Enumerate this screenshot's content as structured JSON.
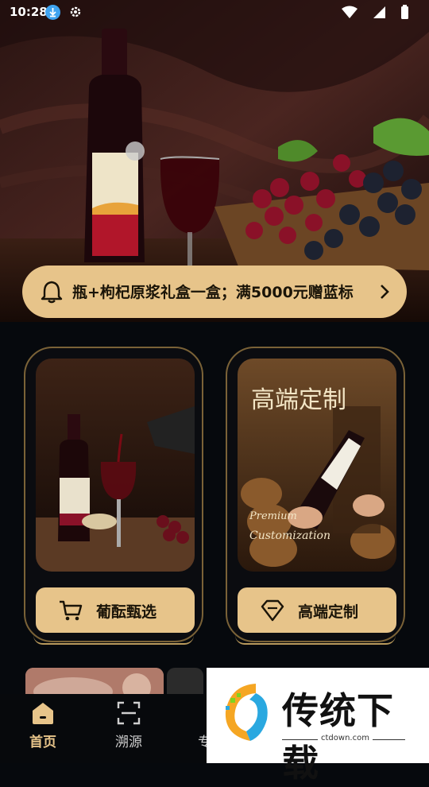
{
  "status_bar": {
    "time": "10:28"
  },
  "notice": {
    "text": "瓶+枸杞原浆礼盒一盒；满5000元赠蓝标"
  },
  "cards": [
    {
      "button_label": "葡酝甄选",
      "button_icon": "cart-icon"
    },
    {
      "image_title": "高端定制",
      "image_subtitle_1": "Premium",
      "image_subtitle_2": "Customization",
      "button_label": "高端定制",
      "button_icon": "diamond-icon"
    }
  ],
  "tabs": [
    {
      "label": "首页",
      "icon": "home-icon",
      "active": true
    },
    {
      "label": "溯源",
      "icon": "scan-icon",
      "active": false
    },
    {
      "label": "专属",
      "icon": "chevron-icon",
      "active": false
    }
  ],
  "watermark": {
    "text": "传统下载",
    "url": "ctdown.com"
  },
  "colors": {
    "accent": "#e7c48a",
    "background": "#06090d",
    "card_border": "#7a6237"
  }
}
